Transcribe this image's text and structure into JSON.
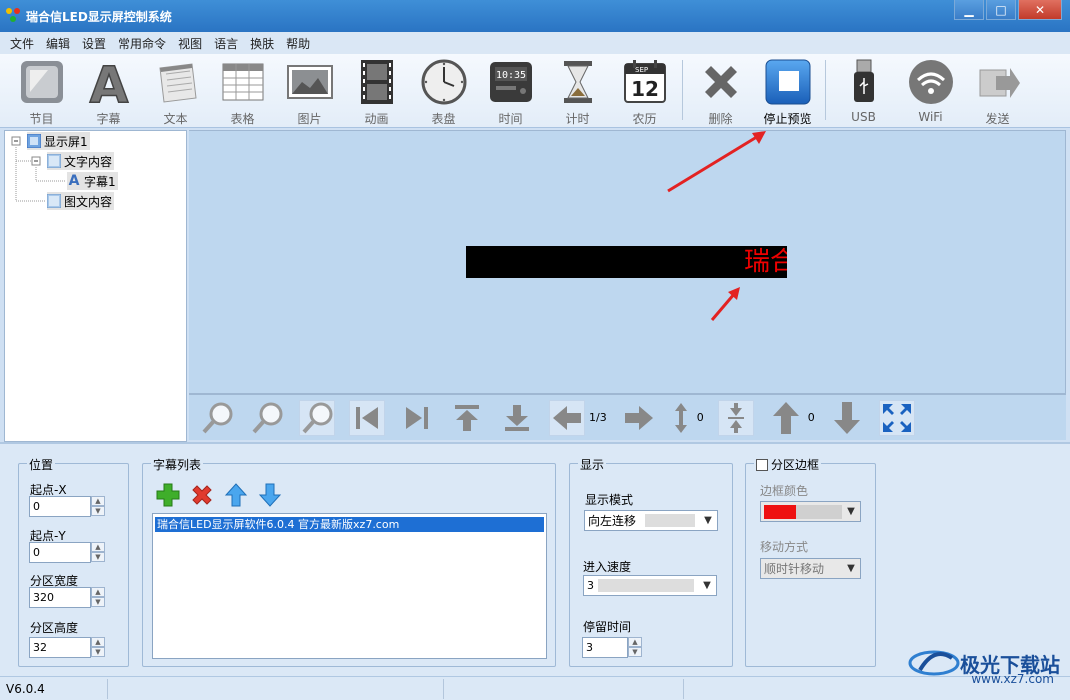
{
  "window": {
    "title": "瑞合信LED显示屏控制系统"
  },
  "menu": [
    "文件",
    "编辑",
    "设置",
    "常用命令",
    "视图",
    "语言",
    "换肤",
    "帮助"
  ],
  "toolbar": [
    {
      "label": "节目",
      "icon": "program-icon"
    },
    {
      "label": "字幕",
      "icon": "subtitle-icon"
    },
    {
      "label": "文本",
      "icon": "text-icon"
    },
    {
      "label": "表格",
      "icon": "table-icon"
    },
    {
      "label": "图片",
      "icon": "picture-icon"
    },
    {
      "label": "动画",
      "icon": "animation-icon"
    },
    {
      "label": "表盘",
      "icon": "clock-dial-icon"
    },
    {
      "label": "时间",
      "icon": "digital-time-icon"
    },
    {
      "label": "计时",
      "icon": "hourglass-icon"
    },
    {
      "label": "农历",
      "icon": "calendar-icon"
    },
    {
      "label": "删除",
      "icon": "delete-icon"
    },
    {
      "label": "停止预览",
      "icon": "stop-preview-icon"
    },
    {
      "label": "USB",
      "icon": "usb-icon"
    },
    {
      "label": "WiFi",
      "icon": "wifi-icon"
    },
    {
      "label": "发送",
      "icon": "send-icon"
    }
  ],
  "calendar_icon": {
    "month": "SEP",
    "day": "12"
  },
  "time_icon": "10:35",
  "tree": {
    "screen": "显示屏1",
    "text_content": "文字内容",
    "subtitle": "字幕1",
    "image_text_content": "图文内容"
  },
  "preview": {
    "led_text": "瑞合"
  },
  "nav": {
    "page": "1/3",
    "v_offset": "0",
    "up_offset": "0"
  },
  "position": {
    "title": "位置",
    "x_label": "起点-X",
    "x": "0",
    "y_label": "起点-Y",
    "y": "0",
    "w_label": "分区宽度",
    "w": "320",
    "h_label": "分区高度",
    "h": "32"
  },
  "subtitles": {
    "title": "字幕列表",
    "items": [
      "瑞合信LED显示屏软件6.0.4 官方最新版xz7.com"
    ]
  },
  "display": {
    "title": "显示",
    "mode_label": "显示模式",
    "mode": "向左连移",
    "speed_label": "进入速度",
    "speed": "3",
    "stay_label": "停留时间",
    "stay": "3"
  },
  "border": {
    "title": "分区边框",
    "color_label": "边框颜色",
    "move_label": "移动方式",
    "move": "顺时针移动",
    "color": "#ee1111"
  },
  "status": {
    "version": "V6.0.4"
  },
  "watermark": {
    "brand": "极光下载站",
    "url": "www.xz7.com"
  }
}
